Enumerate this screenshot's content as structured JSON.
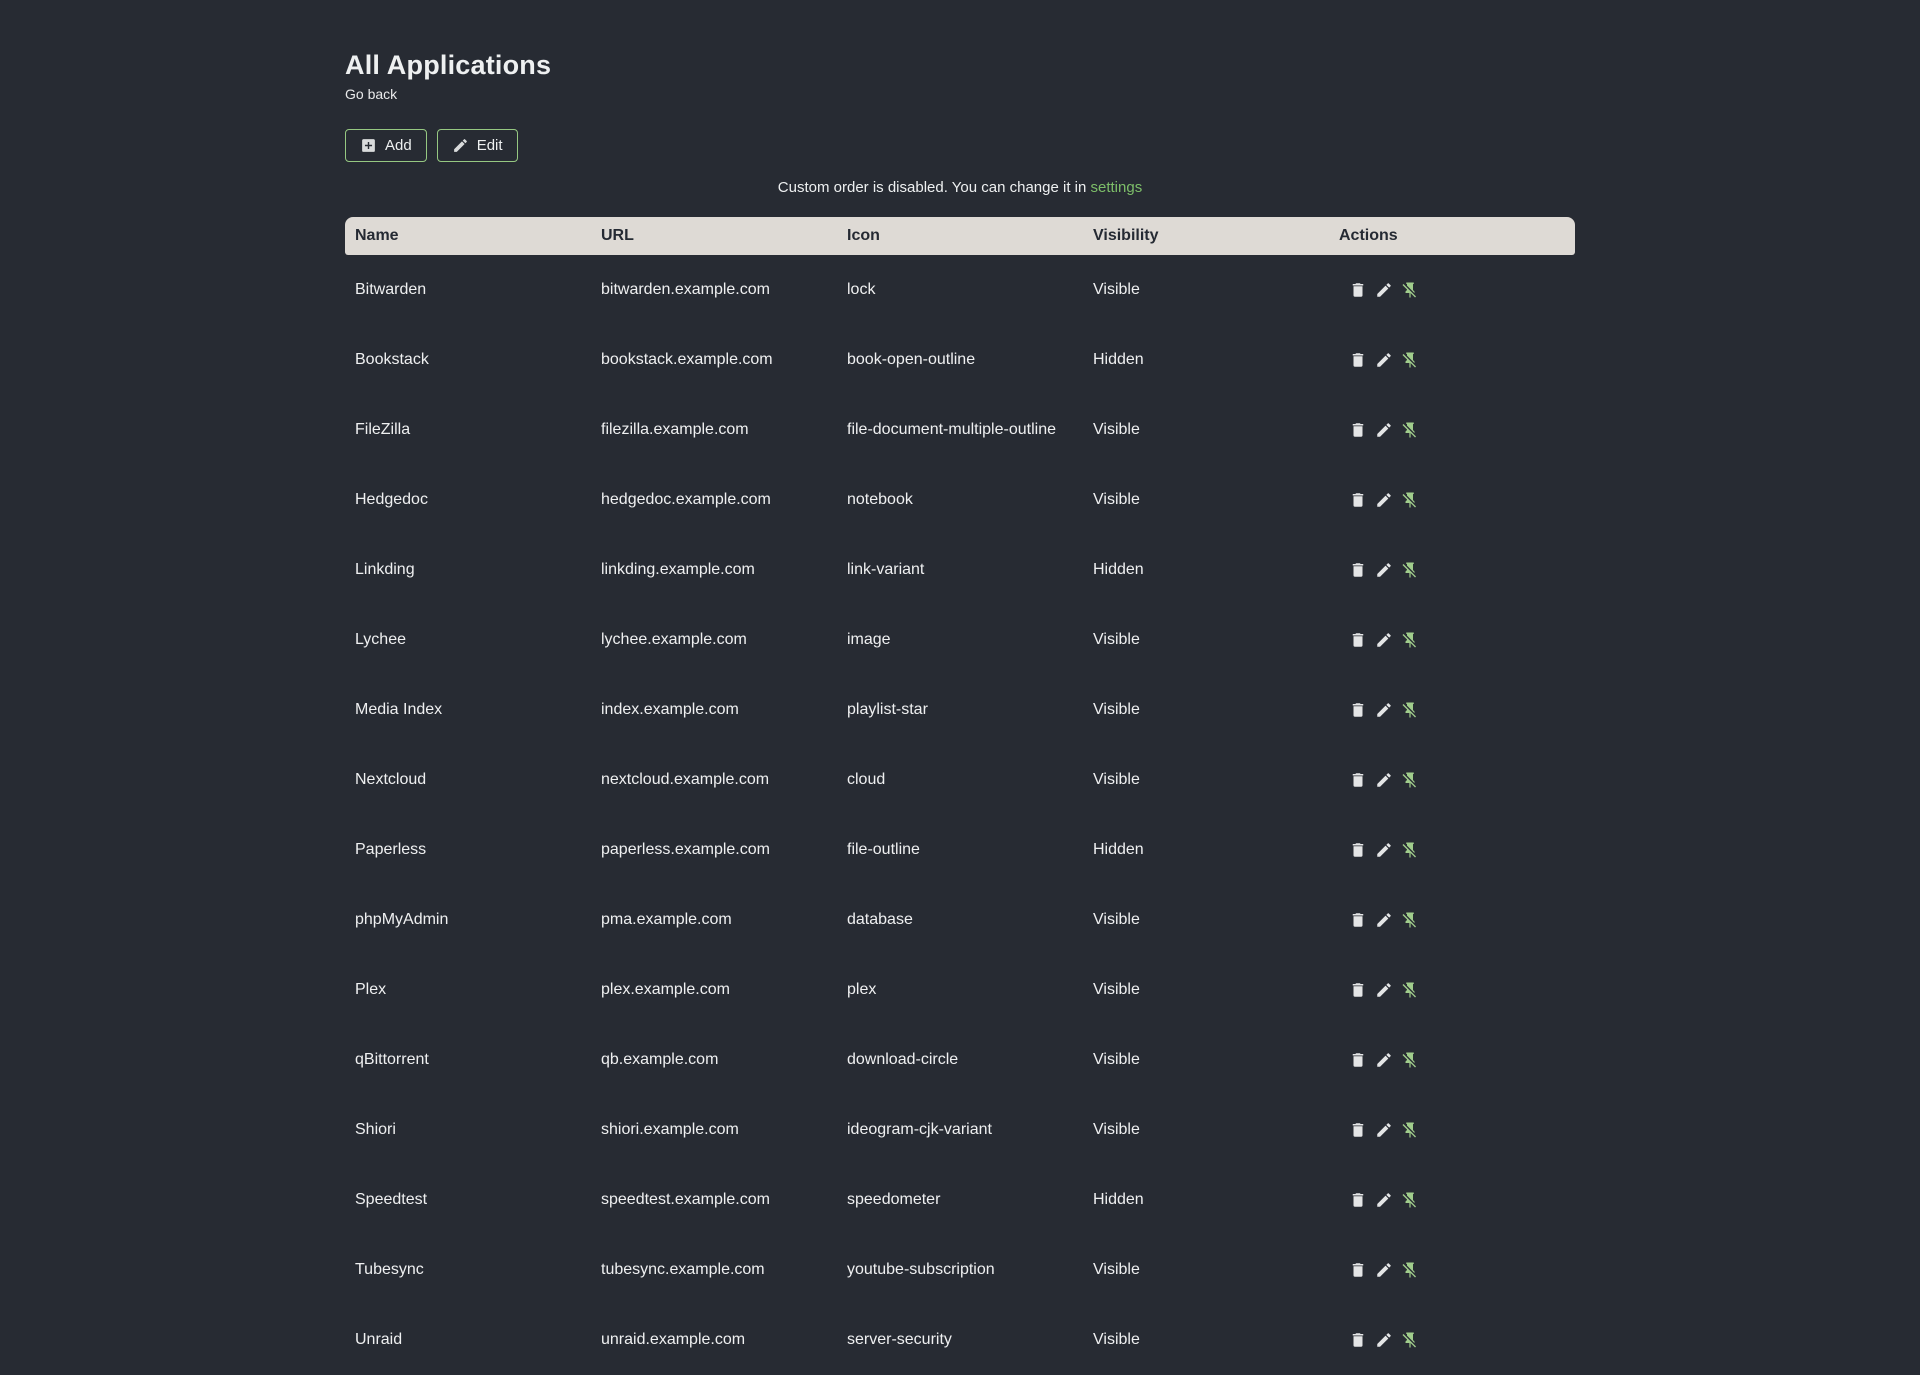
{
  "page": {
    "title": "All Applications",
    "back_label": "Go back",
    "notice_text": "Custom order is disabled. You can change it in",
    "notice_link": "settings"
  },
  "toolbar": {
    "add_label": "Add",
    "edit_label": "Edit"
  },
  "colors": {
    "background": "#272b33",
    "accent_green": "#7dbe69",
    "button_border_green": "#96c882",
    "pin_icon_green": "#a0cd8c",
    "table_header_bg": "#dedad5",
    "table_header_text": "#252a33"
  },
  "icons": {
    "add_button": "plus-box-icon",
    "edit_button": "pencil-icon",
    "row_delete": "trash-icon",
    "row_edit": "pencil-icon",
    "row_pin": "pin-off-icon"
  },
  "table": {
    "headers": [
      "Name",
      "URL",
      "Icon",
      "Visibility",
      "Actions"
    ],
    "rows": [
      {
        "name": "Bitwarden",
        "url": "bitwarden.example.com",
        "icon": "lock",
        "visibility": "Visible"
      },
      {
        "name": "Bookstack",
        "url": "bookstack.example.com",
        "icon": "book-open-outline",
        "visibility": "Hidden"
      },
      {
        "name": "FileZilla",
        "url": "filezilla.example.com",
        "icon": "file-document-multiple-outline",
        "visibility": "Visible"
      },
      {
        "name": "Hedgedoc",
        "url": "hedgedoc.example.com",
        "icon": "notebook",
        "visibility": "Visible"
      },
      {
        "name": "Linkding",
        "url": "linkding.example.com",
        "icon": "link-variant",
        "visibility": "Hidden"
      },
      {
        "name": "Lychee",
        "url": "lychee.example.com",
        "icon": "image",
        "visibility": "Visible"
      },
      {
        "name": "Media Index",
        "url": "index.example.com",
        "icon": "playlist-star",
        "visibility": "Visible"
      },
      {
        "name": "Nextcloud",
        "url": "nextcloud.example.com",
        "icon": "cloud",
        "visibility": "Visible"
      },
      {
        "name": "Paperless",
        "url": "paperless.example.com",
        "icon": "file-outline",
        "visibility": "Hidden"
      },
      {
        "name": "phpMyAdmin",
        "url": "pma.example.com",
        "icon": "database",
        "visibility": "Visible"
      },
      {
        "name": "Plex",
        "url": "plex.example.com",
        "icon": "plex",
        "visibility": "Visible"
      },
      {
        "name": "qBittorrent",
        "url": "qb.example.com",
        "icon": "download-circle",
        "visibility": "Visible"
      },
      {
        "name": "Shiori",
        "url": "shiori.example.com",
        "icon": "ideogram-cjk-variant",
        "visibility": "Visible"
      },
      {
        "name": "Speedtest",
        "url": "speedtest.example.com",
        "icon": "speedometer",
        "visibility": "Hidden"
      },
      {
        "name": "Tubesync",
        "url": "tubesync.example.com",
        "icon": "youtube-subscription",
        "visibility": "Visible"
      },
      {
        "name": "Unraid",
        "url": "unraid.example.com",
        "icon": "server-security",
        "visibility": "Visible"
      }
    ]
  }
}
